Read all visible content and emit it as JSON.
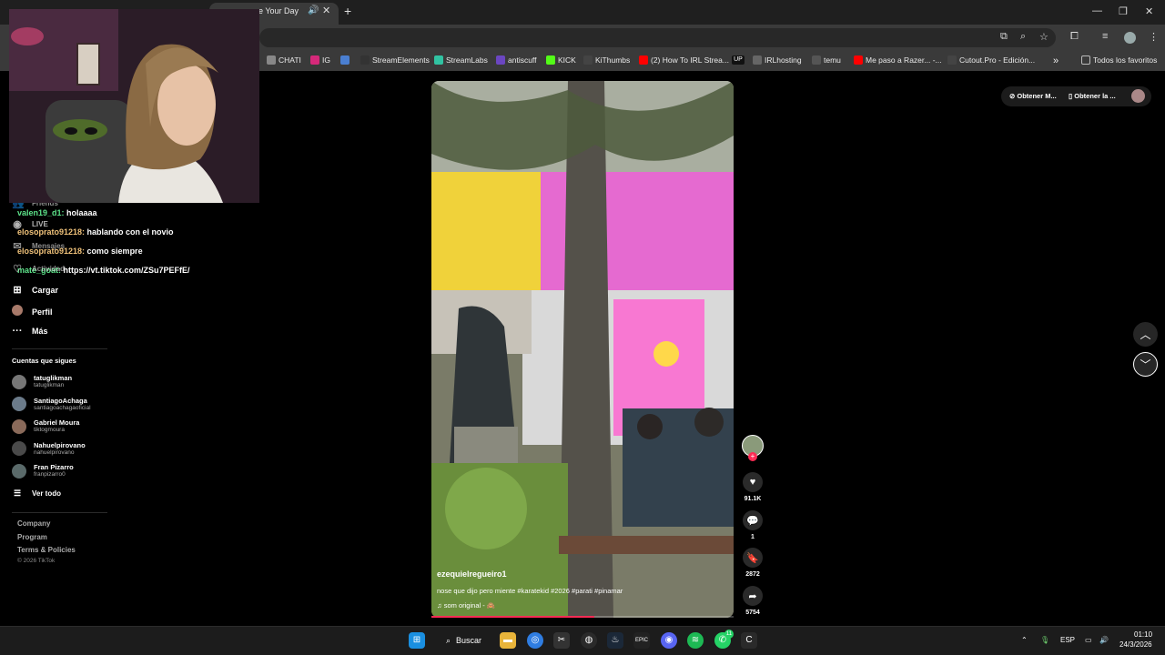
{
  "browser": {
    "tab_title": "e Your Day",
    "bookmarks": [
      {
        "label": "CHATI",
        "icon": "circle-icon",
        "color": "#888888"
      },
      {
        "label": "IG",
        "icon": "instagram-icon",
        "color": "#d6297a"
      },
      {
        "label": "",
        "icon": "chart-icon",
        "color": "#4a7fd1"
      },
      {
        "label": "StreamElements",
        "icon": "streamelements-icon",
        "color": "#333333"
      },
      {
        "label": "StreamLabs",
        "icon": "streamlabs-icon",
        "color": "#31c3a2"
      },
      {
        "label": "antiscuff",
        "icon": "antiscuff-icon",
        "color": "#6b46c1"
      },
      {
        "label": "KICK",
        "icon": "kick-icon",
        "color": "#53fc18"
      },
      {
        "label": "KiThumbs",
        "icon": "kithumbs-icon",
        "color": "#444444"
      },
      {
        "label": "(2) How To IRL Strea...",
        "icon": "youtube-icon",
        "color": "#ff0000"
      },
      {
        "label": "",
        "icon": "up-icon",
        "color": "#111111"
      },
      {
        "label": "IRLhosting",
        "icon": "globe-icon",
        "color": "#666666"
      },
      {
        "label": "temu",
        "icon": "folder-icon",
        "color": "#555555"
      },
      {
        "label": "Me paso a Razer... -...",
        "icon": "youtube-icon",
        "color": "#ff0000"
      },
      {
        "label": "Cutout.Pro - Edición...",
        "icon": "cutout-icon",
        "color": "#444444"
      }
    ],
    "all_bookmarks": "Todos los favoritos",
    "up_badge": "UP"
  },
  "chat": [
    {
      "user": "valen19_d1:",
      "message": "holaaaa",
      "color": "green"
    },
    {
      "user": "elosoprato91218:",
      "message": "hablando con el novio",
      "color": "gold"
    },
    {
      "user": "elosoprato91218:",
      "message": "como siempre",
      "color": "gold"
    },
    {
      "user": "mate_goat:",
      "message": "https://vt.tiktok.com/ZSu7PEFfE/",
      "color": "green"
    }
  ],
  "sidebar": {
    "partial_items": [
      "Friends",
      "LIVE",
      "Mensajes",
      "Actividad"
    ],
    "items": [
      {
        "label": "Cargar",
        "icon": "upload-icon"
      },
      {
        "label": "Perfil",
        "icon": "profile-icon"
      },
      {
        "label": "Más",
        "icon": "more-icon"
      }
    ],
    "following_title": "Cuentas que sigues",
    "following": [
      {
        "name": "tatuglikman",
        "handle": "tatuglikman"
      },
      {
        "name": "SantiagoAchaga",
        "handle": "santiagoachagaoficial"
      },
      {
        "name": "Gabriel Moura",
        "handle": "tiktogmoura"
      },
      {
        "name": "Nahuelpirovano",
        "handle": "nahuelpirovano"
      },
      {
        "name": "Fran Pizarro",
        "handle": "franpizarro0"
      }
    ],
    "see_all": "Ver todo",
    "footer": [
      "Company",
      "Program",
      "Terms & Policies"
    ],
    "copyright": "© 2026 TikTok"
  },
  "video": {
    "username": "ezequielregueiro1",
    "description": "nose que dijo pero miente #karatekid #2026 #parati #pinamar",
    "sound": "som original - 🙈",
    "progress": 0.54
  },
  "actions": {
    "likes": "91.1K",
    "comments": "1",
    "saves": "2872",
    "shares": "5754"
  },
  "top_right": {
    "pill1": "Obtener M...",
    "pill2": "Obtener la ..."
  },
  "taskbar": {
    "search": "Buscar",
    "lang": "ESP",
    "time": "01:10",
    "date": "24/3/2026",
    "whatsapp_badge": "11"
  }
}
